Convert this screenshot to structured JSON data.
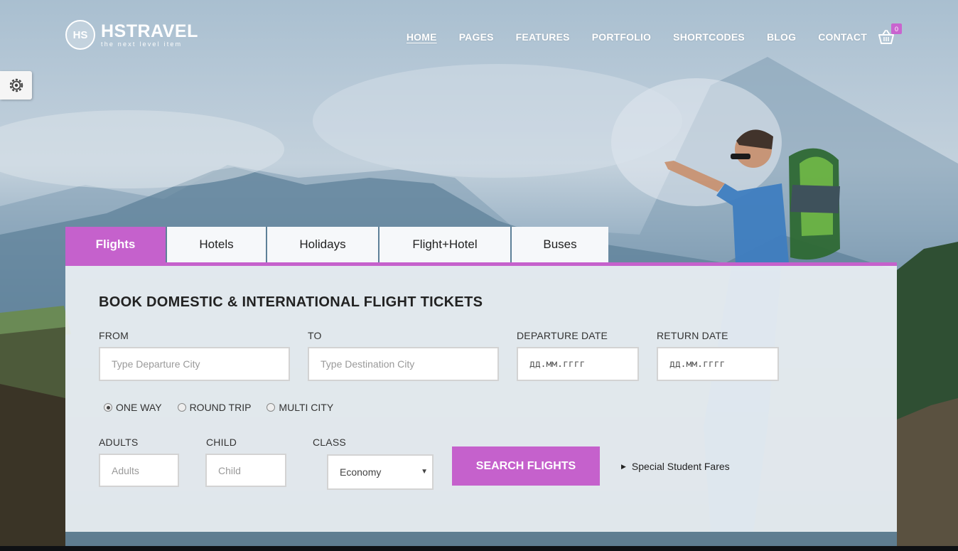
{
  "header": {
    "logo_badge": "HS",
    "logo_name": "HSTRAVEL",
    "logo_tagline": "the next level item",
    "nav": [
      "HOME",
      "PAGES",
      "FEATURES",
      "PORTFOLIO",
      "SHORTCODES",
      "BLOG",
      "CONTACT"
    ],
    "active_nav": "HOME",
    "cart_count": "0"
  },
  "tabs": [
    "Flights",
    "Hotels",
    "Holidays",
    "Flight+Hotel",
    "Buses"
  ],
  "active_tab": "Flights",
  "form": {
    "title": "BOOK DOMESTIC & INTERNATIONAL FLIGHT TICKETS",
    "from_label": "FROM",
    "from_placeholder": "Type Departure City",
    "to_label": "TO",
    "to_placeholder": "Type Destination City",
    "departure_label": "DEPARTURE DATE",
    "departure_value": "дд.мм.гггг",
    "return_label": "RETURN DATE",
    "return_value": "дд.мм.гггг",
    "trip_types": [
      "ONE WAY",
      "ROUND TRIP",
      "MULTI CITY"
    ],
    "selected_trip_type": "ONE WAY",
    "adults_label": "ADULTS",
    "adults_placeholder": "Adults",
    "child_label": "CHILD",
    "child_placeholder": "Child",
    "class_label": "CLASS",
    "class_value": "Economy",
    "search_label": "SEARCH FLIGHTS",
    "student_link": "Special Student Fares"
  },
  "colors": {
    "accent": "#c561cc",
    "tab_divider": "#5d8098"
  },
  "icons": {
    "cart": "basket-icon",
    "settings": "gear-icon",
    "dropdown": "dropdown-arrow-icon",
    "link": "caret-right-icon"
  }
}
